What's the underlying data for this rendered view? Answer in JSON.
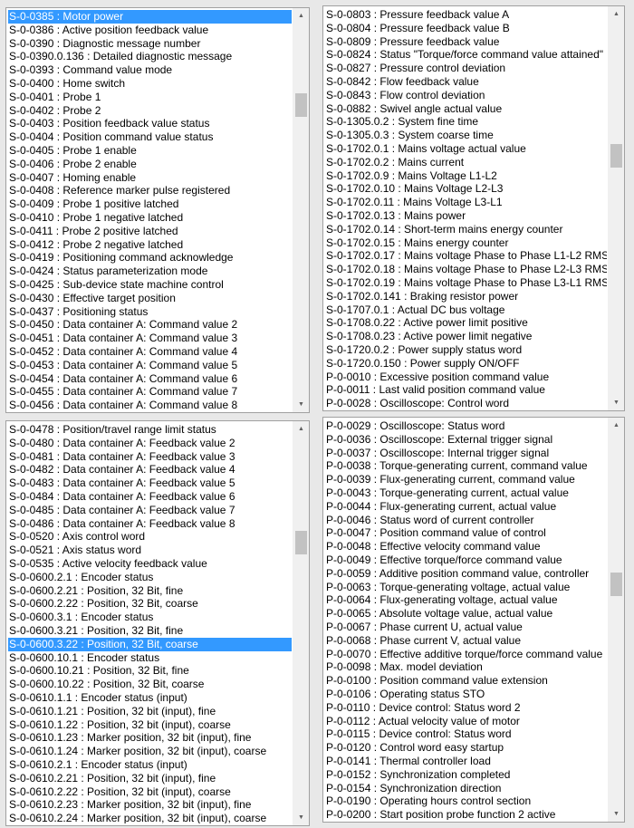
{
  "panels": [
    {
      "selected": 0,
      "scroll_position": 0.2,
      "items": [
        "S-0-0385 : Motor power",
        "S-0-0386 : Active position feedback value",
        "S-0-0390 : Diagnostic message number",
        "S-0-0390.0.136 : Detailed diagnostic message",
        "S-0-0393 : Command value mode",
        "S-0-0400 : Home switch",
        "S-0-0401 : Probe 1",
        "S-0-0402 : Probe 2",
        "S-0-0403 : Position feedback value status",
        "S-0-0404 : Position command value status",
        "S-0-0405 : Probe 1 enable",
        "S-0-0406 : Probe 2 enable",
        "S-0-0407 : Homing enable",
        "S-0-0408 : Reference marker pulse registered",
        "S-0-0409 : Probe 1 positive latched",
        "S-0-0410 : Probe 1 negative latched",
        "S-0-0411 : Probe 2 positive latched",
        "S-0-0412 : Probe 2 negative latched",
        "S-0-0419 : Positioning command acknowledge",
        "S-0-0424 : Status parameterization mode",
        "S-0-0425 : Sub-device state machine control",
        "S-0-0430 : Effective target position",
        "S-0-0437 : Positioning status",
        "S-0-0450 : Data container A: Command value 2",
        "S-0-0451 : Data container A: Command value 3",
        "S-0-0452 : Data container A: Command value 4",
        "S-0-0453 : Data container A: Command value 5",
        "S-0-0454 : Data container A: Command value 6",
        "S-0-0455 : Data container A: Command value 7",
        "S-0-0456 : Data container A: Command value 8"
      ]
    },
    {
      "selected": -1,
      "scroll_position": 0.35,
      "items": [
        "S-0-0803 : Pressure feedback value A",
        "S-0-0804 : Pressure feedback value B",
        "S-0-0809 : Pressure feedback value",
        "S-0-0824 : Status \"Torque/force command value attained\"",
        "S-0-0827 : Pressure control deviation",
        "S-0-0842 : Flow feedback value",
        "S-0-0843 : Flow control deviation",
        "S-0-0882 : Swivel angle actual value",
        "S-0-1305.0.2 : System fine time",
        "S-0-1305.0.3 : System coarse time",
        "S-0-1702.0.1 : Mains voltage actual value",
        "S-0-1702.0.2 : Mains current",
        "S-0-1702.0.9 : Mains Voltage L1-L2",
        "S-0-1702.0.10 : Mains Voltage L2-L3",
        "S-0-1702.0.11 : Mains Voltage L3-L1",
        "S-0-1702.0.13 : Mains power",
        "S-0-1702.0.14 : Short-term mains energy counter",
        "S-0-1702.0.15 : Mains energy counter",
        "S-0-1702.0.17 : Mains voltage Phase to Phase L1-L2 RMS",
        "S-0-1702.0.18 : Mains voltage Phase to Phase L2-L3 RMS",
        "S-0-1702.0.19 : Mains voltage Phase to Phase L3-L1 RMS",
        "S-0-1702.0.141 : Braking resistor power",
        "S-0-1707.0.1 : Actual DC bus voltage",
        "S-0-1708.0.22 : Active power limit positive",
        "S-0-1708.0.23 : Active power limit negative",
        "S-0-1720.0.2 : Power supply status word",
        "S-0-1720.0.150 : Power supply ON/OFF",
        "P-0-0010 : Excessive position command value",
        "P-0-0011 : Last valid position command value",
        "P-0-0028 : Oscilloscope: Control word"
      ]
    },
    {
      "selected": 16,
      "scroll_position": 0.27,
      "items": [
        "S-0-0478 : Position/travel range limit status",
        "S-0-0480 : Data container A: Feedback value 2",
        "S-0-0481 : Data container A: Feedback value 3",
        "S-0-0482 : Data container A: Feedback value 4",
        "S-0-0483 : Data container A: Feedback value 5",
        "S-0-0484 : Data container A: Feedback value 6",
        "S-0-0485 : Data container A: Feedback value 7",
        "S-0-0486 : Data container A: Feedback value 8",
        "S-0-0520 : Axis control word",
        "S-0-0521 : Axis status word",
        "S-0-0535 : Active velocity feedback value",
        "S-0-0600.2.1 : Encoder status",
        "S-0-0600.2.21 : Position, 32 Bit, fine",
        "S-0-0600.2.22 : Position, 32 Bit, coarse",
        "S-0-0600.3.1 : Encoder status",
        "S-0-0600.3.21 : Position, 32 Bit, fine",
        "S-0-0600.3.22 : Position, 32 Bit, coarse",
        "S-0-0600.10.1 : Encoder status",
        "S-0-0600.10.21 : Position, 32 Bit, fine",
        "S-0-0600.10.22 : Position, 32 Bit, coarse",
        "S-0-0610.1.1 : Encoder status (input)",
        "S-0-0610.1.21 : Position, 32 bit (input), fine",
        "S-0-0610.1.22 : Position, 32 bit (input), coarse",
        "S-0-0610.1.23 : Marker position, 32 bit (input), fine",
        "S-0-0610.1.24 : Marker position, 32 bit (input), coarse",
        "S-0-0610.2.1 : Encoder status (input)",
        "S-0-0610.2.21 : Position, 32 bit (input), fine",
        "S-0-0610.2.22 : Position, 32 bit (input), coarse",
        "S-0-0610.2.23 : Marker position, 32 bit (input), fine",
        "S-0-0610.2.24 : Marker position, 32 bit (input), coarse"
      ]
    },
    {
      "selected": -1,
      "scroll_position": 0.4,
      "items": [
        "P-0-0029 : Oscilloscope: Status word",
        "P-0-0036 : Oscilloscope: External trigger signal",
        "P-0-0037 : Oscilloscope: Internal trigger signal",
        "P-0-0038 : Torque-generating current, command value",
        "P-0-0039 : Flux-generating current, command value",
        "P-0-0043 : Torque-generating current, actual value",
        "P-0-0044 : Flux-generating current, actual value",
        "P-0-0046 : Status word of current controller",
        "P-0-0047 : Position command value of control",
        "P-0-0048 : Effective velocity command value",
        "P-0-0049 : Effective torque/force command value",
        "P-0-0059 : Additive position command value, controller",
        "P-0-0063 : Torque-generating voltage, actual value",
        "P-0-0064 : Flux-generating voltage, actual value",
        "P-0-0065 : Absolute voltage value, actual value",
        "P-0-0067 : Phase current U, actual value",
        "P-0-0068 : Phase current V, actual value",
        "P-0-0070 : Effective additive torque/force command value",
        "P-0-0098 : Max. model deviation",
        "P-0-0100 : Position command value extension",
        "P-0-0106 : Operating status STO",
        "P-0-0110 : Device control: Status word 2",
        "P-0-0112 : Actual velocity value of motor",
        "P-0-0115 : Device control: Status word",
        "P-0-0120 : Control word easy startup",
        "P-0-0141 : Thermal controller load",
        "P-0-0152 : Synchronization completed",
        "P-0-0154 : Synchronization direction",
        "P-0-0190 : Operating hours control section",
        "P-0-0200 : Start position probe function 2 active"
      ]
    }
  ],
  "icons": {
    "scroll_up": "chevron-up-icon",
    "scroll_down": "chevron-down-icon"
  },
  "colors": {
    "selection": "#3399ff",
    "selection_text": "#ffffff"
  }
}
